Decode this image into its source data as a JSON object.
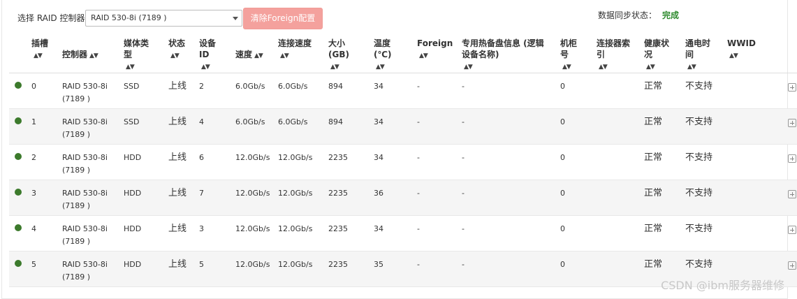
{
  "toolbar": {
    "controller_label": "选择 RAID 控制器",
    "controller_selected": "RAID 530-8i (7189 )",
    "clear_foreign_label": "清除Foreign配置",
    "sync_label": "数据同步状态：",
    "sync_value": "完成"
  },
  "table": {
    "headers": [
      "插槽",
      "控制器",
      "媒体类型",
      "状态",
      "设备ID",
      "速度",
      "连接速度",
      "大小(GB)",
      "温度(℃)",
      "Foreign",
      "专用热备盘信息 (逻辑设备名称)",
      "机柜号",
      "连接器索引",
      "健康状况",
      "通电时间",
      "WWID"
    ],
    "rows": [
      {
        "slot": "0",
        "controller": "RAID 530-8i (7189 )",
        "media": "SSD",
        "state": "上线",
        "device_id": "2",
        "speed": "6.0Gb/s",
        "link_speed": "6.0Gb/s",
        "size": "894",
        "temp": "34",
        "foreign": "-",
        "hotspare": "-",
        "enclosure": "0",
        "connector": "",
        "health": "正常",
        "power_on": "不支持",
        "wwid": ""
      },
      {
        "slot": "1",
        "controller": "RAID 530-8i (7189 )",
        "media": "SSD",
        "state": "上线",
        "device_id": "4",
        "speed": "6.0Gb/s",
        "link_speed": "6.0Gb/s",
        "size": "894",
        "temp": "34",
        "foreign": "-",
        "hotspare": "-",
        "enclosure": "0",
        "connector": "",
        "health": "正常",
        "power_on": "不支持",
        "wwid": ""
      },
      {
        "slot": "2",
        "controller": "RAID 530-8i (7189 )",
        "media": "HDD",
        "state": "上线",
        "device_id": "6",
        "speed": "12.0Gb/s",
        "link_speed": "12.0Gb/s",
        "size": "2235",
        "temp": "34",
        "foreign": "-",
        "hotspare": "-",
        "enclosure": "0",
        "connector": "",
        "health": "正常",
        "power_on": "不支持",
        "wwid": ""
      },
      {
        "slot": "3",
        "controller": "RAID 530-8i (7189 )",
        "media": "HDD",
        "state": "上线",
        "device_id": "7",
        "speed": "12.0Gb/s",
        "link_speed": "12.0Gb/s",
        "size": "2235",
        "temp": "36",
        "foreign": "-",
        "hotspare": "-",
        "enclosure": "0",
        "connector": "",
        "health": "正常",
        "power_on": "不支持",
        "wwid": ""
      },
      {
        "slot": "4",
        "controller": "RAID 530-8i (7189 )",
        "media": "HDD",
        "state": "上线",
        "device_id": "3",
        "speed": "12.0Gb/s",
        "link_speed": "12.0Gb/s",
        "size": "2235",
        "temp": "34",
        "foreign": "-",
        "hotspare": "-",
        "enclosure": "0",
        "connector": "",
        "health": "正常",
        "power_on": "不支持",
        "wwid": ""
      },
      {
        "slot": "5",
        "controller": "RAID 530-8i (7189 )",
        "media": "HDD",
        "state": "上线",
        "device_id": "5",
        "speed": "12.0Gb/s",
        "link_speed": "12.0Gb/s",
        "size": "2235",
        "temp": "35",
        "foreign": "-",
        "hotspare": "-",
        "enclosure": "0",
        "connector": "",
        "health": "正常",
        "power_on": "不支持",
        "wwid": ""
      }
    ]
  },
  "icons": {
    "status": "status-dot-icon",
    "expand": "expand-plus-icon",
    "sort": "sort-arrows-icon",
    "dropdown": "chevron-down-icon"
  },
  "colors": {
    "status_online": "#3c7a2c",
    "sync_complete": "#2e8b2e",
    "foreign_button": "#f4a19d"
  },
  "watermark": "CSDN @ibm服务器维修"
}
